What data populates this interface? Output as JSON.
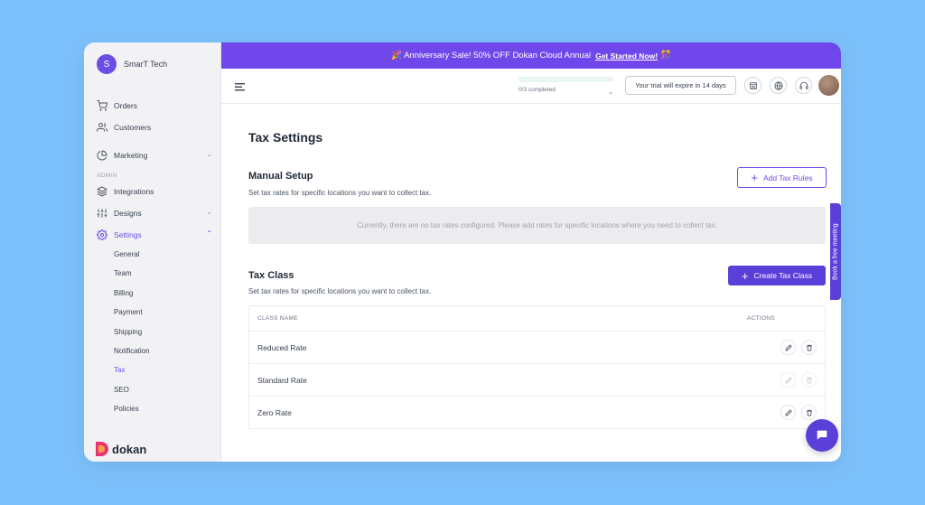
{
  "store": {
    "initial": "S",
    "name": "SmarT Tech"
  },
  "sidebar": {
    "items": [
      {
        "label": "Orders",
        "icon": "cart-icon"
      },
      {
        "label": "Customers",
        "icon": "users-icon"
      },
      {
        "label": "Marketing",
        "icon": "pie-chart-icon"
      },
      {
        "label": "Integrations",
        "icon": "layers-icon"
      },
      {
        "label": "Designs",
        "icon": "sliders-icon"
      },
      {
        "label": "Settings",
        "icon": "gear-icon"
      }
    ],
    "admin_label": "ADMIN",
    "settings_sub": [
      "General",
      "Team",
      "Billing",
      "Payment",
      "Shipping",
      "Notification",
      "Tax",
      "SEO",
      "Policies"
    ],
    "active_sub": "Tax",
    "logo_text": "dokan"
  },
  "banner": {
    "text": "🎉 Anniversary Sale! 50% OFF Dokan Cloud Annual",
    "link": "Get Started Now!",
    "emoji_end": "🎊"
  },
  "header": {
    "progress_text": "0/3 completed",
    "progress_fraction": 0,
    "trial_text": "Your trial will expire in 14 days"
  },
  "page": {
    "title": "Tax Settings",
    "manual": {
      "title": "Manual Setup",
      "desc": "Set tax rates for specific locations you want to collect tax.",
      "button": "Add Tax Rules",
      "empty": "Currently, there are no tax rates configured. Please add rates for specific locations where you need to collect tax."
    },
    "tax_class": {
      "title": "Tax Class",
      "desc": "Set tax rates for specific locations you want to collect tax.",
      "button": "Create Tax Class",
      "columns": [
        "CLASS NAME",
        "ACTIONS"
      ],
      "rows": [
        "Reduced Rate",
        "Standard Rate",
        "Zero Rate"
      ]
    }
  },
  "side_tab": "Book a free meeting",
  "colors": {
    "accent": "#7047eb",
    "button": "#5b3fd9",
    "background": "#7cc0fb"
  }
}
